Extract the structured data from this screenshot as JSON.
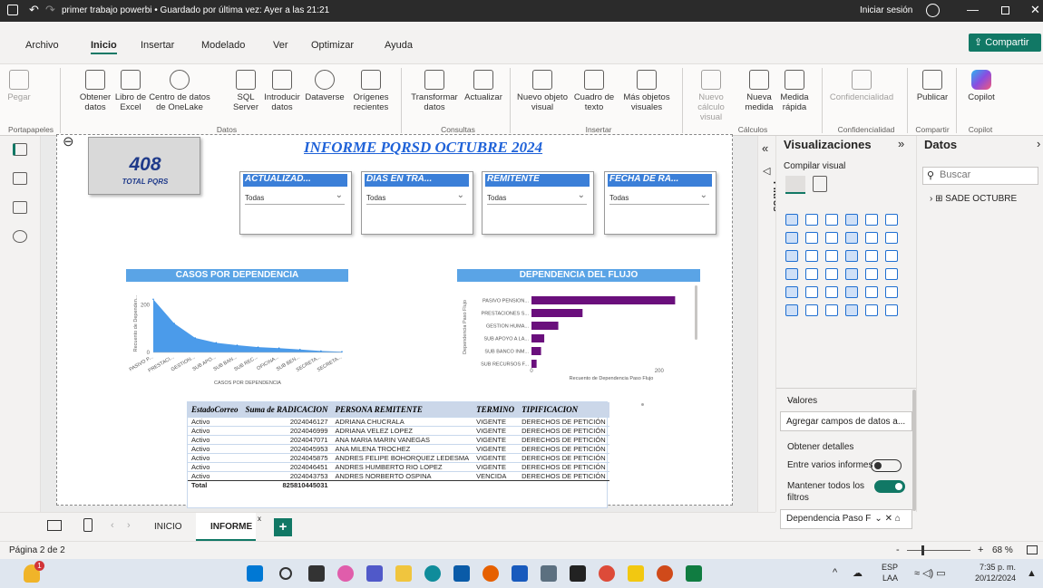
{
  "titlebar": {
    "doc_title": "primer trabajo powerbi • Guardado por última vez: Ayer a las 21:21",
    "signin": "Iniciar sesión"
  },
  "menu": {
    "tabs": [
      "Archivo",
      "Inicio",
      "Insertar",
      "Modelado",
      "Ver",
      "Optimizar",
      "Ayuda"
    ],
    "share": "Compartir"
  },
  "ribbon": {
    "paste": "Pegar",
    "get_data": "Obtener datos",
    "excel": "Libro de Excel",
    "onelake": "Centro de datos de OneLake",
    "sql": "SQL Server",
    "enter_data": "Introducir datos",
    "dataverse": "Dataverse",
    "recent": "Orígenes recientes",
    "transform": "Transformar datos",
    "refresh": "Actualizar",
    "new_visual": "Nuevo objeto visual",
    "textbox": "Cuadro de texto",
    "more_visuals": "Más objetos visuales",
    "new_calc": "Nuevo cálculo visual",
    "new_measure": "Nueva medida",
    "quick_measure": "Medida rápida",
    "sensitivity": "Confidencialidad",
    "publish": "Publicar",
    "copilot": "Copilot",
    "groups": {
      "clipboard": "Portapapeles",
      "data": "Datos",
      "queries": "Consultas",
      "insert": "Insertar",
      "calcs": "Cálculos",
      "sensitivity": "Confidencialidad",
      "share": "Compartir",
      "copilot": "Copilot"
    }
  },
  "report": {
    "title": "INFORME PQRSD OCTUBRE 2024",
    "card_value": "408",
    "card_label": "TOTAL PQRS",
    "slicers": [
      {
        "title": "ACTUALIZAD...",
        "value": "Todas"
      },
      {
        "title": "DIAS EN TRA...",
        "value": "Todas"
      },
      {
        "title": "REMITENTE",
        "value": "Todas"
      },
      {
        "title": "FECHA DE RA...",
        "value": "Todas"
      }
    ]
  },
  "chart_data": [
    {
      "type": "area",
      "title": "CASOS POR DEPENDENCIA",
      "xlabel": "CASOS POR DEPENDENCIA",
      "ylabel": "Recuento de Dependen...",
      "categories": [
        "PASIVO P...",
        "PRESTACI...",
        "GESTION...",
        "SUB APO...",
        "SUB BAN...",
        "SUB REC...",
        "OFICINA...",
        "SUB BEN...",
        "SECRETA...",
        "SECRETA..."
      ],
      "values": [
        220,
        120,
        60,
        40,
        30,
        22,
        18,
        12,
        6,
        3
      ],
      "yticks": [
        "200",
        "0"
      ],
      "ylim": [
        0,
        240
      ],
      "color": "#2b8ae6"
    },
    {
      "type": "bar",
      "orientation": "horizontal",
      "title": "DEPENDENCIA DEL FLUJO",
      "xlabel": "Recuento de Dependencia Paso Flujo",
      "ylabel": "Dependencia Paso Flujo",
      "categories": [
        "PASIVO PENSION...",
        "PRESTACIONES S...",
        "GESTION HUMA...",
        "SUB APOYO A LA...",
        "SUB BANCO INM...",
        "SUB RECURSOS F..."
      ],
      "values": [
        225,
        80,
        42,
        20,
        15,
        8
      ],
      "xticks": [
        "0",
        "200"
      ],
      "xlim": [
        0,
        250
      ],
      "color": "#6a0f7c"
    }
  ],
  "table": {
    "headers": [
      "EstadoCorreo",
      "Suma de RADICACION",
      "PERSONA REMITENTE",
      "TERMINO",
      "TIPIFICACION"
    ],
    "rows": [
      [
        "Activo",
        "2024046127",
        "ADRIANA CHUCRALA",
        "VIGENTE",
        "DERECHOS DE PETICIÓN"
      ],
      [
        "Activo",
        "2024046999",
        "ADRIANA VELEZ LOPEZ",
        "VIGENTE",
        "DERECHOS DE PETICIÓN"
      ],
      [
        "Activo",
        "2024047071",
        "ANA MARIA MARIN VANEGAS",
        "VIGENTE",
        "DERECHOS DE PETICIÓN"
      ],
      [
        "Activo",
        "2024045953",
        "ANA MILENA TROCHEZ",
        "VIGENTE",
        "DERECHOS DE PETICIÓN"
      ],
      [
        "Activo",
        "2024045875",
        "ANDRES FELIPE BOHORQUEZ LEDESMA",
        "VIGENTE",
        "DERECHOS DE PETICIÓN"
      ],
      [
        "Activo",
        "2024046451",
        "ANDRES HUMBERTO RIO LOPEZ",
        "VIGENTE",
        "DERECHOS DE PETICIÓN"
      ],
      [
        "Activo",
        "2024043753",
        "ANDRES NORBERTO OSPINA",
        "VENCIDA",
        "DERECHOS DE PETICIÓN"
      ]
    ],
    "total_label": "Total",
    "total_value": "825810445031"
  },
  "filters_label": "Filtros",
  "viz_pane": {
    "title": "Visualizaciones",
    "build": "Compilar visual",
    "values": "Valores",
    "add_fields": "Agregar campos de datos a...",
    "drill": "Obtener detalles",
    "cross_report": "Entre varios informes",
    "keep_filters": "Mantener todos los filtros",
    "field_chip": "Dependencia Paso F",
    "ellipsis": "..."
  },
  "data_pane": {
    "title": "Datos",
    "search_placeholder": "Buscar",
    "table_name": "SADE OCTUBRE"
  },
  "tabs": {
    "pages": [
      "INICIO",
      "INFORME"
    ],
    "page_indicator": "Página 2 de 2",
    "zoom": "68 %"
  },
  "taskbar": {
    "lang1": "ESP",
    "lang2": "LAA",
    "time": "7:35 p. m.",
    "date": "20/12/2024",
    "badge": "1"
  }
}
